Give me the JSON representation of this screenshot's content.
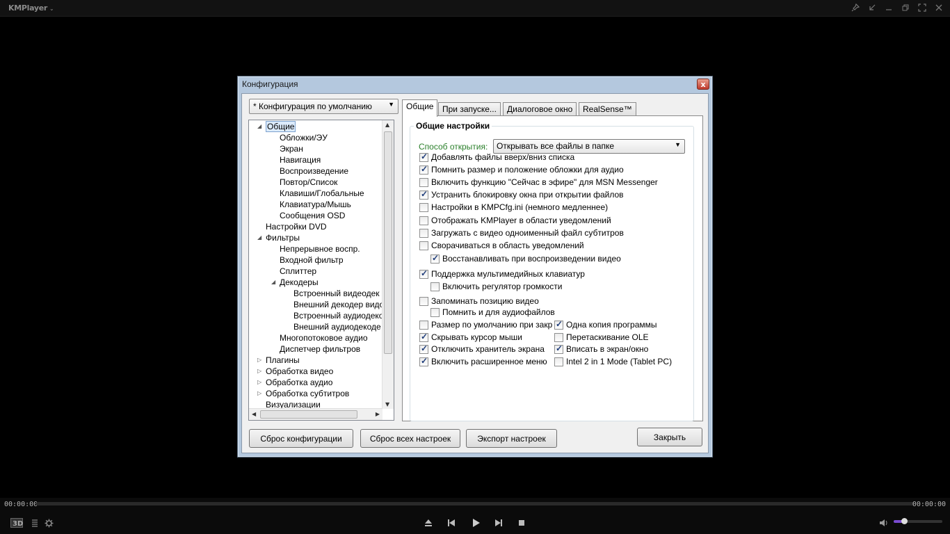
{
  "player": {
    "app_name": "KMPlayer",
    "time_elapsed": "00:00:00",
    "time_total": "00:00:00",
    "volume_level": 0.22,
    "accent_color": "#7a4bd1"
  },
  "dialog": {
    "title": "Конфигурация",
    "close_glyph": "x",
    "preset": "* Конфигурация по умолчанию",
    "tree": [
      {
        "label": "Общие",
        "level": 0,
        "expander": "open",
        "selected": true
      },
      {
        "label": "Обложки/ЭУ",
        "level": 1
      },
      {
        "label": "Экран",
        "level": 1
      },
      {
        "label": "Навигация",
        "level": 1
      },
      {
        "label": "Воспроизведение",
        "level": 1
      },
      {
        "label": "Повтор/Список",
        "level": 1
      },
      {
        "label": "Клавиши/Глобальные",
        "level": 1
      },
      {
        "label": "Клавиатура/Мышь",
        "level": 1
      },
      {
        "label": "Сообщения OSD",
        "level": 1
      },
      {
        "label": "Настройки DVD",
        "level": 0
      },
      {
        "label": "Фильтры",
        "level": 0,
        "expander": "open"
      },
      {
        "label": "Непрерывное воспр.",
        "level": 1
      },
      {
        "label": "Входной фильтр",
        "level": 1
      },
      {
        "label": "Сплиттер",
        "level": 1
      },
      {
        "label": "Декодеры",
        "level": 1,
        "expander": "open"
      },
      {
        "label": "Встроенный видеодек",
        "level": 2
      },
      {
        "label": "Внешний декодер видо",
        "level": 2
      },
      {
        "label": "Встроенный аудиодеко",
        "level": 2
      },
      {
        "label": "Внешний аудиодекоде",
        "level": 2
      },
      {
        "label": "Многопотоковое аудио",
        "level": 1
      },
      {
        "label": "Диспетчер фильтров",
        "level": 1
      },
      {
        "label": "Плагины",
        "level": 0,
        "expander": "closed"
      },
      {
        "label": "Обработка видео",
        "level": 0,
        "expander": "closed"
      },
      {
        "label": "Обработка аудио",
        "level": 0,
        "expander": "closed"
      },
      {
        "label": "Обработка субтитров",
        "level": 0,
        "expander": "closed"
      },
      {
        "label": "Визуализации",
        "level": 0
      }
    ],
    "tabs": [
      "Общие",
      "При запуске...",
      "Диалоговое окно",
      "RealSense™"
    ],
    "group_title": "Общие настройки",
    "open_mode_label": "Способ открытия:",
    "open_mode_value": "Открывать все файлы в папке",
    "checkboxes": [
      {
        "label": "Добавлять файлы вверх/вниз списка",
        "checked": true
      },
      {
        "label": "Помнить размер и положение обложки для аудио",
        "checked": true
      },
      {
        "label": "Включить функцию \"Сейчас в эфире\" для MSN Messenger",
        "checked": false
      },
      {
        "label": "Устранить блокировку окна при открытии файлов",
        "checked": true
      },
      {
        "label": "Настройки в KMPCfg.ini (немного медленнее)",
        "checked": false
      },
      {
        "label": "Отображать KMPlayer в области уведомлений",
        "checked": false
      },
      {
        "label": "Загружать с видео одноименный файл субтитров",
        "checked": false
      },
      {
        "label": "Сворачиваться в область уведомлений",
        "checked": false
      },
      {
        "label": "Восстанавливать при воспроизведении видео",
        "checked": true
      },
      {
        "label": "Поддержка мультимедийных клавиатур",
        "checked": true
      },
      {
        "label": "Включить регулятор громкости",
        "checked": false
      },
      {
        "label": "Запоминать позицию видео",
        "checked": false
      },
      {
        "label": "Помнить и для аудиофайлов",
        "checked": false
      },
      {
        "label": "Размер по умолчанию при закр",
        "checked": false
      },
      {
        "label": "Одна копия программы",
        "checked": true
      },
      {
        "label": "Скрывать курсор мыши",
        "checked": true
      },
      {
        "label": "Перетаскивание OLE",
        "checked": false
      },
      {
        "label": "Отключить хранитель экрана",
        "checked": true
      },
      {
        "label": "Вписать в экран/окно",
        "checked": true
      },
      {
        "label": "Включить расширенное меню",
        "checked": true
      },
      {
        "label": "Intel 2 in 1 Mode (Tablet PC)",
        "checked": false
      }
    ],
    "buttons": {
      "reset_config": "Сброс конфигурации",
      "reset_all": "Сброс всех настроек",
      "export": "Экспорт настроек",
      "close": "Закрыть"
    }
  }
}
